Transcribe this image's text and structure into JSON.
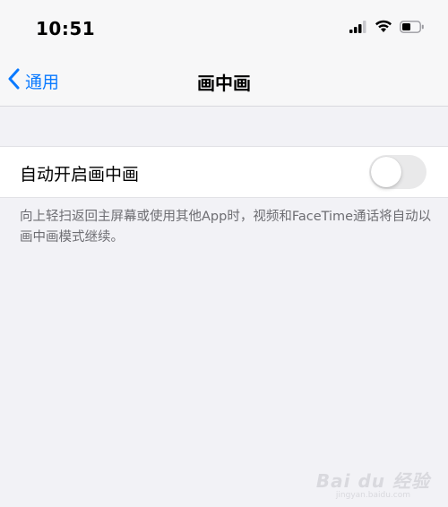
{
  "status_bar": {
    "time": "10:51",
    "icons": [
      "signal-icon",
      "wifi-icon",
      "battery-icon"
    ]
  },
  "nav": {
    "back_label": "通用",
    "title": "画中画"
  },
  "setting": {
    "label": "自动开启画中画",
    "toggle_on": false
  },
  "footer_note": "向上轻扫返回主屏幕或使用其他App时，视频和FaceTime通话将自动以画中画模式继续。",
  "watermark": {
    "logo_text": "Bai du 经验",
    "url": "jingyan.baidu.com"
  },
  "colors": {
    "accent": "#0a7aff",
    "background": "#f2f2f6",
    "toggle_off": "#e9e9ea"
  }
}
